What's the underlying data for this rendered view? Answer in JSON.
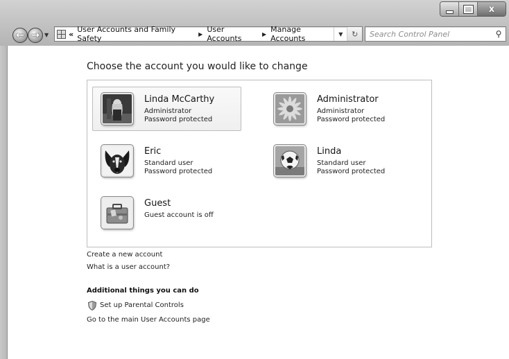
{
  "window": {
    "minimize_label": "–",
    "maximize_label": "□",
    "close_label": "x"
  },
  "nav": {
    "back_icon": "arrow-left-icon",
    "forward_icon": "arrow-right-icon",
    "overflow": "«",
    "breadcrumbs": [
      "User Accounts and Family Safety",
      "User Accounts",
      "Manage Accounts"
    ],
    "search_placeholder": "Search Control Panel"
  },
  "main": {
    "title": "Choose the account you would like to change",
    "accounts": [
      {
        "name": "Linda McCarthy",
        "type": "Administrator",
        "status": "Password protected",
        "avatar": "photo-avatar"
      },
      {
        "name": "Administrator",
        "type": "Administrator",
        "status": "Password protected",
        "avatar": "flower-avatar"
      },
      {
        "name": "Eric",
        "type": "Standard user",
        "status": "Password protected",
        "avatar": "dog-avatar"
      },
      {
        "name": "Linda",
        "type": "Standard user",
        "status": "Password protected",
        "avatar": "soccer-ball-avatar"
      },
      {
        "name": "Guest",
        "type": "Guest account is off",
        "avatar": "suitcase-avatar"
      }
    ],
    "links": {
      "create_account": "Create a new account",
      "what_is": "What is a user account?"
    },
    "additional": {
      "heading": "Additional things you can do",
      "parental_controls": "Set up Parental Controls",
      "main_page": "Go to the main User Accounts page"
    }
  }
}
